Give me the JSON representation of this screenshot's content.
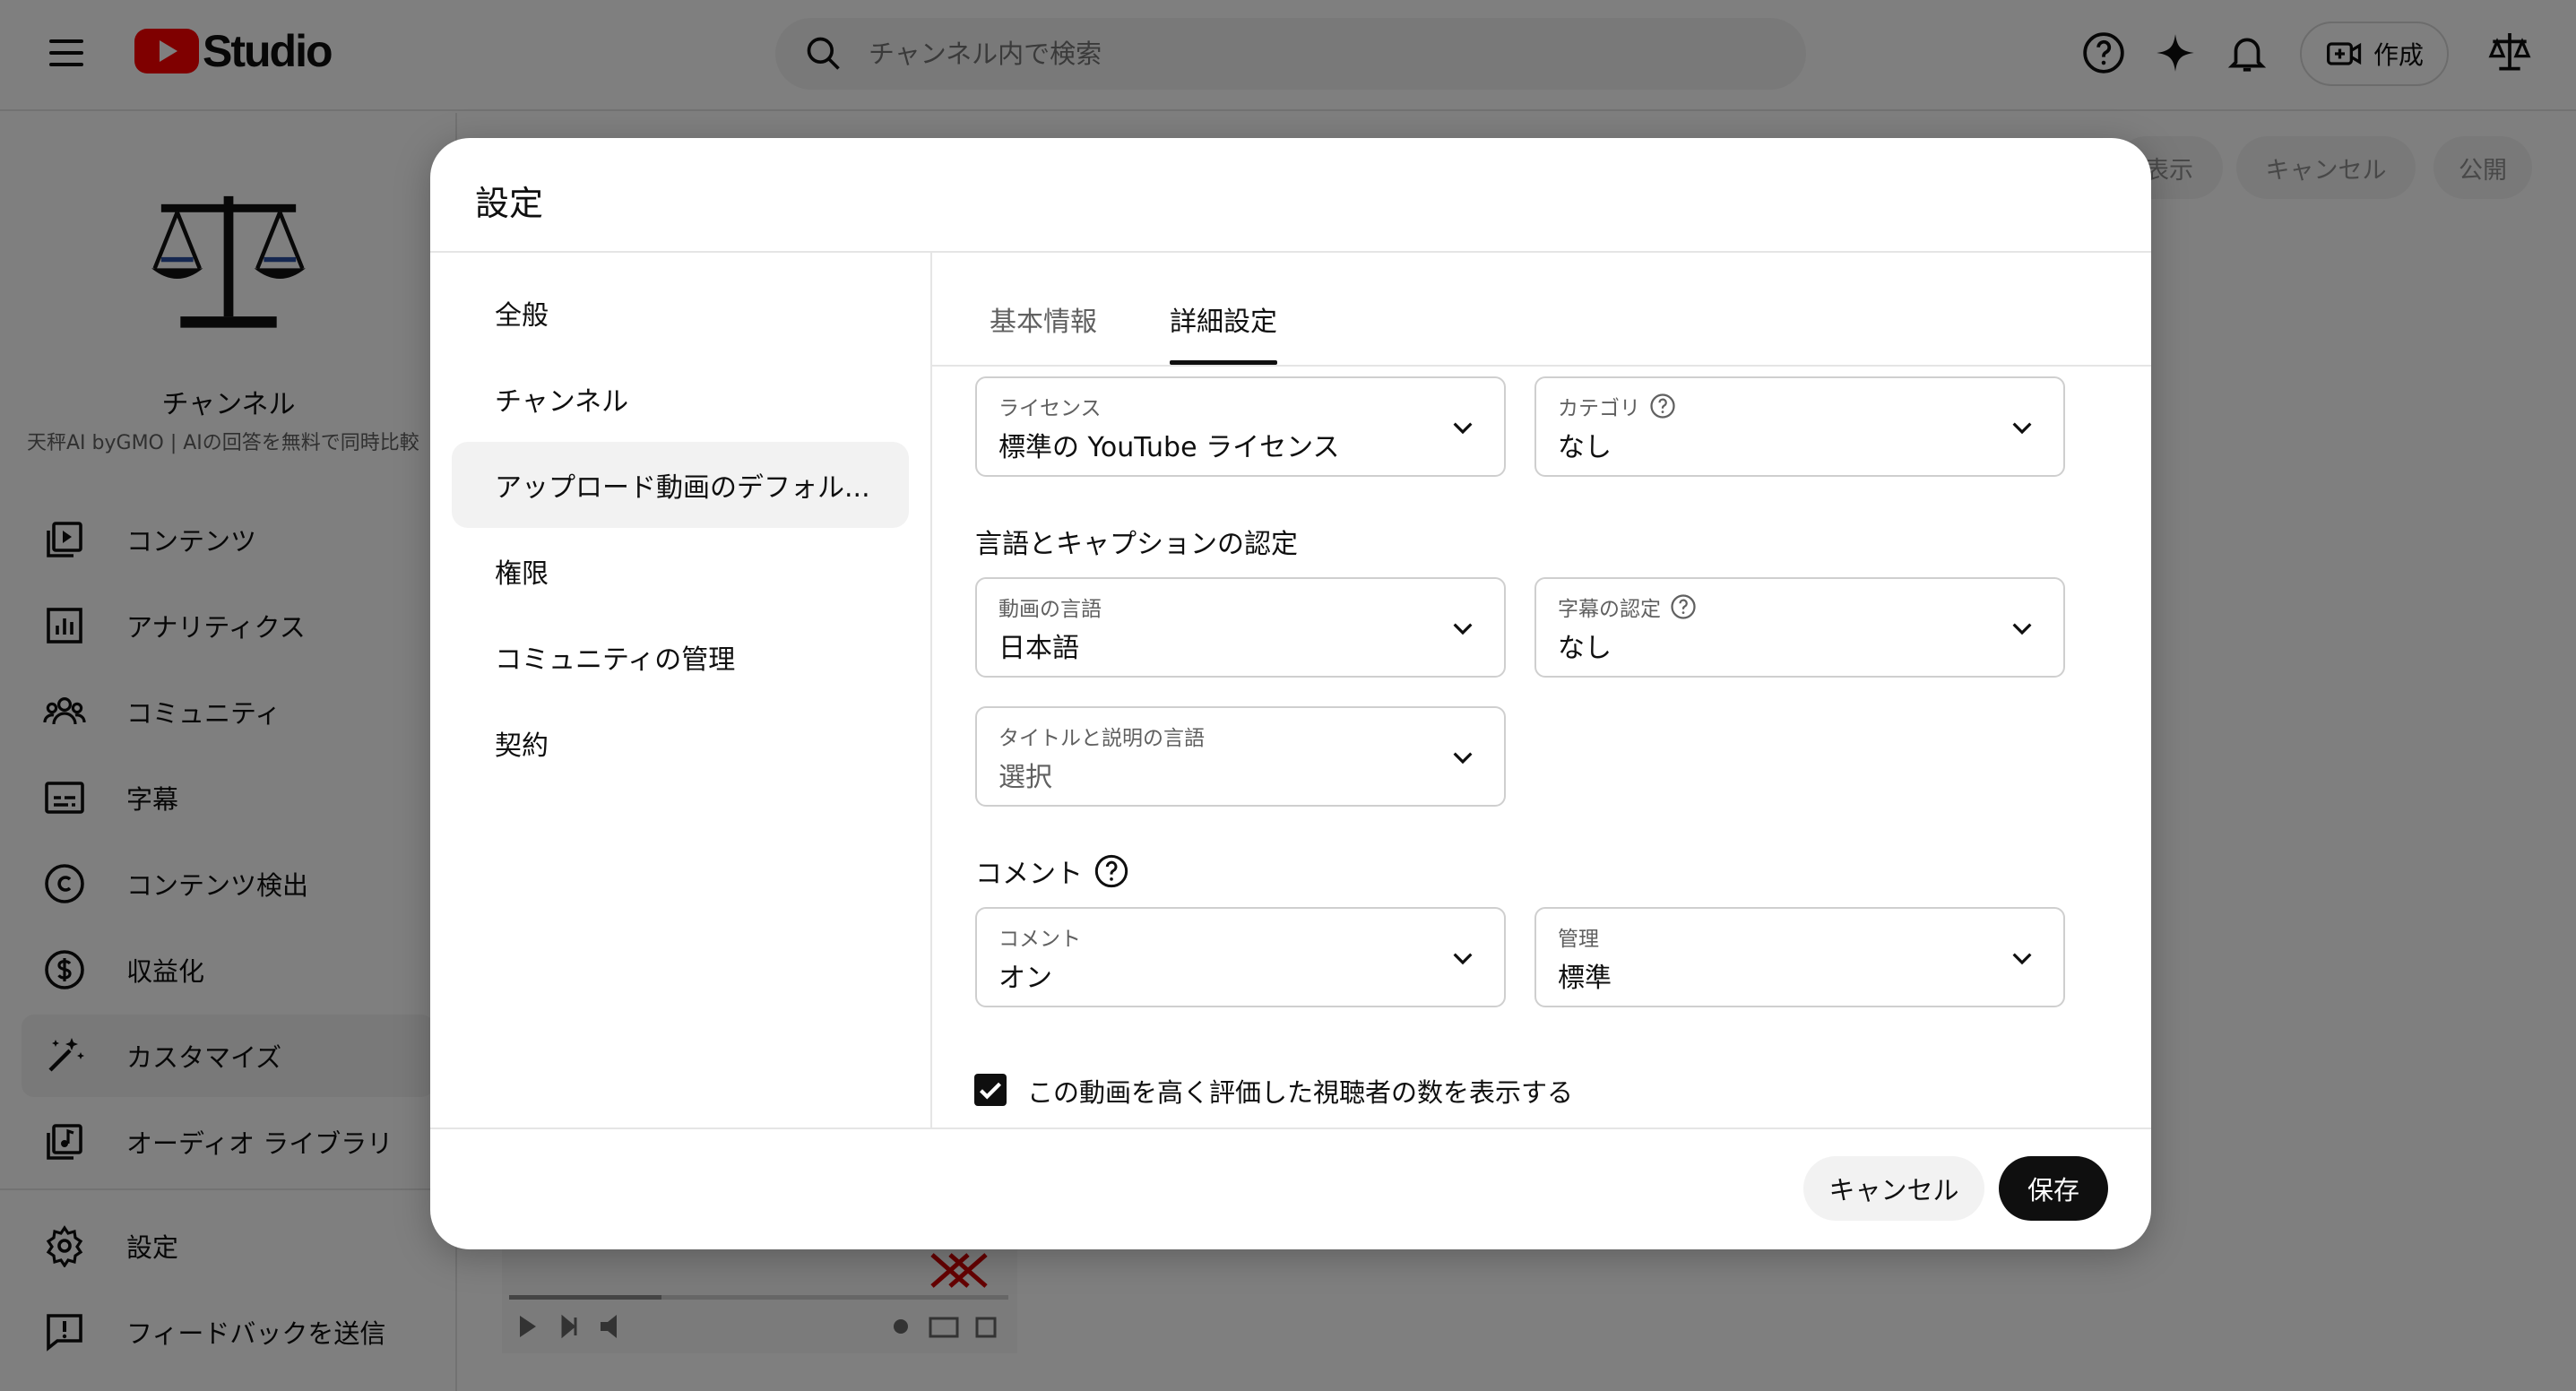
{
  "app": {
    "logo_text": "Studio",
    "search_placeholder": "チャンネル内で検索",
    "create_label": "作成"
  },
  "sidebar": {
    "channel_name": "チャンネル",
    "channel_sub": "天秤AI byGMO | AIの回答を無料で同時比較",
    "items": [
      {
        "label": "コンテンツ",
        "icon": "content-icon"
      },
      {
        "label": "アナリティクス",
        "icon": "analytics-icon"
      },
      {
        "label": "コミュニティ",
        "icon": "community-icon"
      },
      {
        "label": "字幕",
        "icon": "subtitles-icon"
      },
      {
        "label": "コンテンツ検出",
        "icon": "copyright-icon"
      },
      {
        "label": "収益化",
        "icon": "monetization-icon"
      },
      {
        "label": "カスタマイズ",
        "icon": "customize-icon"
      },
      {
        "label": "オーディオ ライブラリ",
        "icon": "audio-library-icon"
      }
    ],
    "bottom_items": [
      {
        "label": "設定",
        "icon": "gear-icon"
      },
      {
        "label": "フィードバックを送信",
        "icon": "feedback-icon"
      }
    ]
  },
  "background_buttons": {
    "preview": "表示",
    "cancel": "キャンセル",
    "publish": "公開"
  },
  "dialog": {
    "title": "設定",
    "nav": [
      {
        "label": "全般"
      },
      {
        "label": "チャンネル"
      },
      {
        "label": "アップロード動画のデフォル..."
      },
      {
        "label": "権限"
      },
      {
        "label": "コミュニティの管理"
      },
      {
        "label": "契約"
      }
    ],
    "tabs": [
      {
        "label": "基本情報"
      },
      {
        "label": "詳細設定"
      }
    ],
    "fields": {
      "license": {
        "label": "ライセンス",
        "value": "標準の YouTube ライセンス"
      },
      "category": {
        "label": "カテゴリ",
        "value": "なし"
      },
      "video_language": {
        "label": "動画の言語",
        "value": "日本語"
      },
      "caption_cert": {
        "label": "字幕の認定",
        "value": "なし"
      },
      "title_language": {
        "label": "タイトルと説明の言語",
        "value": "選択"
      },
      "comments": {
        "label": "コメント",
        "value": "オン"
      },
      "moderation": {
        "label": "管理",
        "value": "標準"
      }
    },
    "sections": {
      "language_captions": "言語とキャプションの認定",
      "comments": "コメント"
    },
    "checkbox": {
      "label": "この動画を高く評価した視聴者の数を表示する",
      "checked": true
    },
    "cancel_label": "キャンセル",
    "save_label": "保存"
  }
}
